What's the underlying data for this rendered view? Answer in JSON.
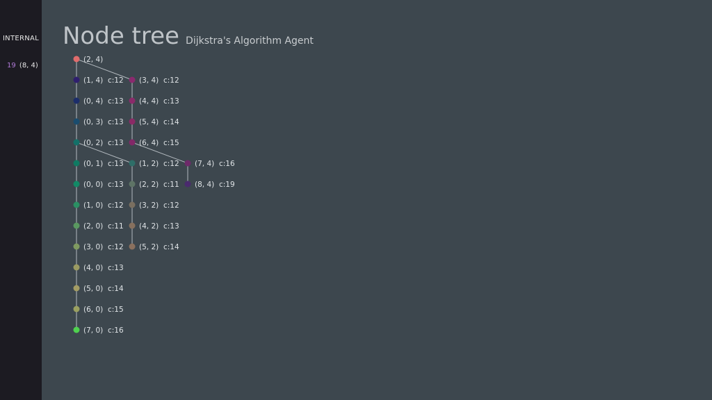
{
  "sidebar": {
    "label": "INTERNAL",
    "goal_cost": "19",
    "goal_node": "(8, 4)"
  },
  "header": {
    "title": "Node tree",
    "subtitle": "Dijkstra's Algorithm Agent"
  },
  "nodes": [
    {
      "id": "2,4",
      "label": "(2, 4)",
      "cost": "",
      "color": "#e06c6c",
      "parent": null,
      "col": 0,
      "row": 0
    },
    {
      "id": "1,4",
      "label": "(1, 4)",
      "cost": "c:12",
      "color": "#2f1f6e",
      "parent": "2,4",
      "col": 0,
      "row": 1
    },
    {
      "id": "0,4",
      "label": "(0, 4)",
      "cost": "c:13",
      "color": "#1c2d6a",
      "parent": "1,4",
      "col": 0,
      "row": 2
    },
    {
      "id": "0,3",
      "label": "(0, 3)",
      "cost": "c:13",
      "color": "#1a4c6e",
      "parent": "0,4",
      "col": 0,
      "row": 3
    },
    {
      "id": "0,2",
      "label": "(0, 2)",
      "cost": "c:13",
      "color": "#137068",
      "parent": "0,3",
      "col": 0,
      "row": 4
    },
    {
      "id": "0,1",
      "label": "(0, 1)",
      "cost": "c:13",
      "color": "#0f7a62",
      "parent": "0,2",
      "col": 0,
      "row": 5
    },
    {
      "id": "0,0",
      "label": "(0, 0)",
      "cost": "c:13",
      "color": "#128a66",
      "parent": "0,1",
      "col": 0,
      "row": 6
    },
    {
      "id": "1,0",
      "label": "(1, 0)",
      "cost": "c:12",
      "color": "#2a9063",
      "parent": "0,0",
      "col": 0,
      "row": 7
    },
    {
      "id": "2,0",
      "label": "(2, 0)",
      "cost": "c:11",
      "color": "#5a9860",
      "parent": "1,0",
      "col": 0,
      "row": 8
    },
    {
      "id": "3,0",
      "label": "(3, 0)",
      "cost": "c:12",
      "color": "#7f9a60",
      "parent": "2,0",
      "col": 0,
      "row": 9
    },
    {
      "id": "4,0",
      "label": "(4, 0)",
      "cost": "c:13",
      "color": "#9a9a62",
      "parent": "3,0",
      "col": 0,
      "row": 10
    },
    {
      "id": "5,0",
      "label": "(5, 0)",
      "cost": "c:14",
      "color": "#a39c64",
      "parent": "4,0",
      "col": 0,
      "row": 11
    },
    {
      "id": "6,0",
      "label": "(6, 0)",
      "cost": "c:15",
      "color": "#9aa060",
      "parent": "5,0",
      "col": 0,
      "row": 12
    },
    {
      "id": "7,0",
      "label": "(7, 0)",
      "cost": "c:16",
      "color": "#4fd14f",
      "parent": "6,0",
      "col": 0,
      "row": 13
    },
    {
      "id": "3,4",
      "label": "(3, 4)",
      "cost": "c:12",
      "color": "#8a2a6e",
      "parent": "2,4",
      "col": 1,
      "row": 1
    },
    {
      "id": "4,4",
      "label": "(4, 4)",
      "cost": "c:13",
      "color": "#8a2a6a",
      "parent": "3,4",
      "col": 1,
      "row": 2
    },
    {
      "id": "5,4",
      "label": "(5, 4)",
      "cost": "c:14",
      "color": "#8a2a66",
      "parent": "4,4",
      "col": 1,
      "row": 3
    },
    {
      "id": "6,4",
      "label": "(6, 4)",
      "cost": "c:15",
      "color": "#822868",
      "parent": "5,4",
      "col": 1,
      "row": 4
    },
    {
      "id": "1,2",
      "label": "(1, 2)",
      "cost": "c:12",
      "color": "#2e6e68",
      "parent": "0,2",
      "col": 1,
      "row": 5
    },
    {
      "id": "2,2",
      "label": "(2, 2)",
      "cost": "c:11",
      "color": "#5e7466",
      "parent": "1,2",
      "col": 1,
      "row": 6
    },
    {
      "id": "3,2",
      "label": "(3, 2)",
      "cost": "c:12",
      "color": "#7a6f60",
      "parent": "2,2",
      "col": 1,
      "row": 7
    },
    {
      "id": "4,2",
      "label": "(4, 2)",
      "cost": "c:13",
      "color": "#86705e",
      "parent": "3,2",
      "col": 1,
      "row": 8
    },
    {
      "id": "5,2",
      "label": "(5, 2)",
      "cost": "c:14",
      "color": "#8a705e",
      "parent": "4,2",
      "col": 1,
      "row": 9
    },
    {
      "id": "7,4",
      "label": "(7, 4)",
      "cost": "c:16",
      "color": "#6e2a6a",
      "parent": "6,4",
      "col": 2,
      "row": 5
    },
    {
      "id": "8,4",
      "label": "(8, 4)",
      "cost": "c:19",
      "color": "#4a2a6e",
      "parent": "7,4",
      "col": 2,
      "row": 6
    }
  ]
}
